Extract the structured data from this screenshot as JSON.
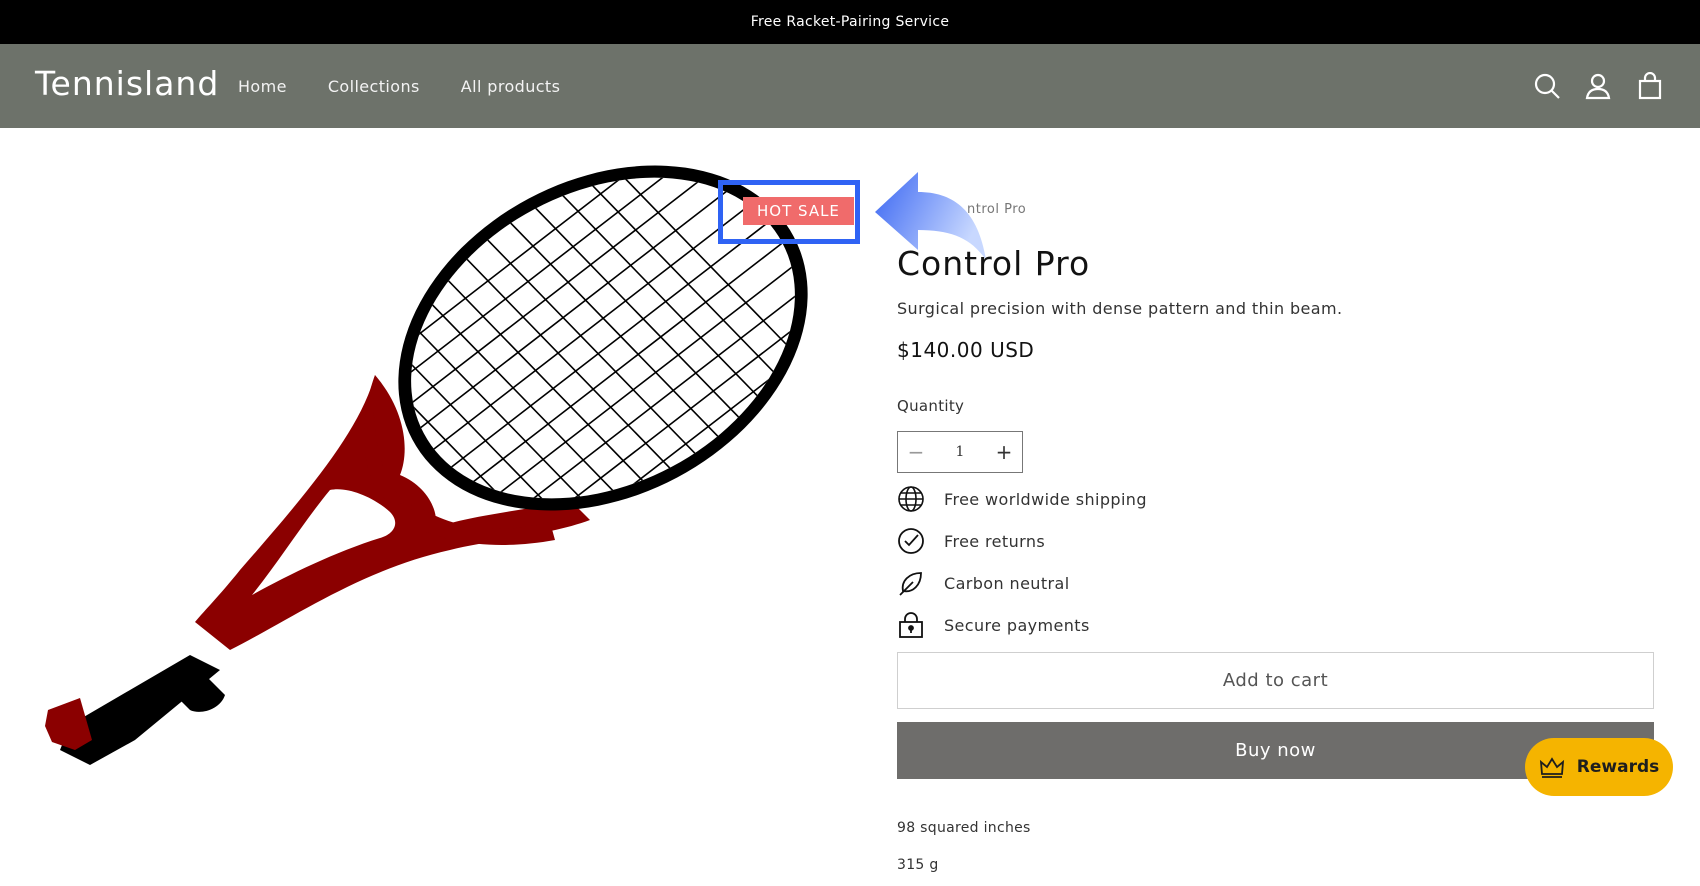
{
  "announcement": {
    "text": "Free Racket-Pairing Service"
  },
  "header": {
    "logo": "Tennisland",
    "nav": [
      "Home",
      "Collections",
      "All products"
    ],
    "icons": [
      "search-icon",
      "account-icon",
      "cart-icon"
    ]
  },
  "product": {
    "badge": "HOT SALE",
    "vendor_partial": "ntrol Pro",
    "title": "Control Pro",
    "description": "Surgical precision with dense pattern and thin beam.",
    "price": "$140.00 USD",
    "quantity_label": "Quantity",
    "quantity_value": "1",
    "stepper": {
      "minus": "−",
      "plus": "+"
    },
    "features": [
      {
        "icon": "globe-icon",
        "label": "Free worldwide shipping"
      },
      {
        "icon": "check-circle-icon",
        "label": "Free returns"
      },
      {
        "icon": "leaf-icon",
        "label": "Carbon neutral"
      },
      {
        "icon": "lock-icon",
        "label": "Secure payments"
      }
    ],
    "add_to_cart": "Add to cart",
    "buy_now": "Buy now",
    "specs": [
      "98 squared inches",
      "315 g"
    ]
  },
  "rewards": {
    "label": "Rewards",
    "icon": "crown-icon"
  },
  "colors": {
    "header_bg": "#6d726a",
    "badge_bg": "#f06b6b",
    "highlight_border": "#2f63f4",
    "buy_now_bg": "#6e6d6b",
    "rewards_bg": "#f5b400",
    "racket_frame": "#8b0000"
  }
}
